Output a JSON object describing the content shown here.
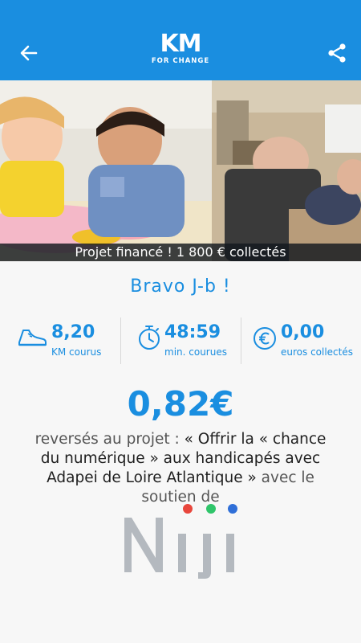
{
  "app_bar": {
    "logo_main": "KM",
    "logo_sub": "FOR CHANGE",
    "back_icon": "arrow-left-icon",
    "share_icon": "share-icon",
    "color": "#1a8ee0"
  },
  "photo": {
    "caption": "Projet financé ! 1 800 € collectés"
  },
  "greeting": "Bravo J-b !",
  "stats": [
    {
      "icon": "running-shoe-icon",
      "value": "8,20",
      "label": "KM courus"
    },
    {
      "icon": "stopwatch-icon",
      "value": "48:59",
      "label": "min. courues"
    },
    {
      "icon": "euro-coin-icon",
      "value": "0,00",
      "label": "euros collectés"
    }
  ],
  "donation": {
    "amount": "0,82€",
    "text_prefix": "reversés au projet : ",
    "project_name": "« Offrir la « chance du numérique » aux handicapés avec Adapei de Loire Atlantique »",
    "text_suffix": " avec le soutien de"
  },
  "sponsor": {
    "name": "Niji",
    "dot_colors": [
      "#e8463c",
      "#2fc56a",
      "#2f6fd8"
    ]
  }
}
